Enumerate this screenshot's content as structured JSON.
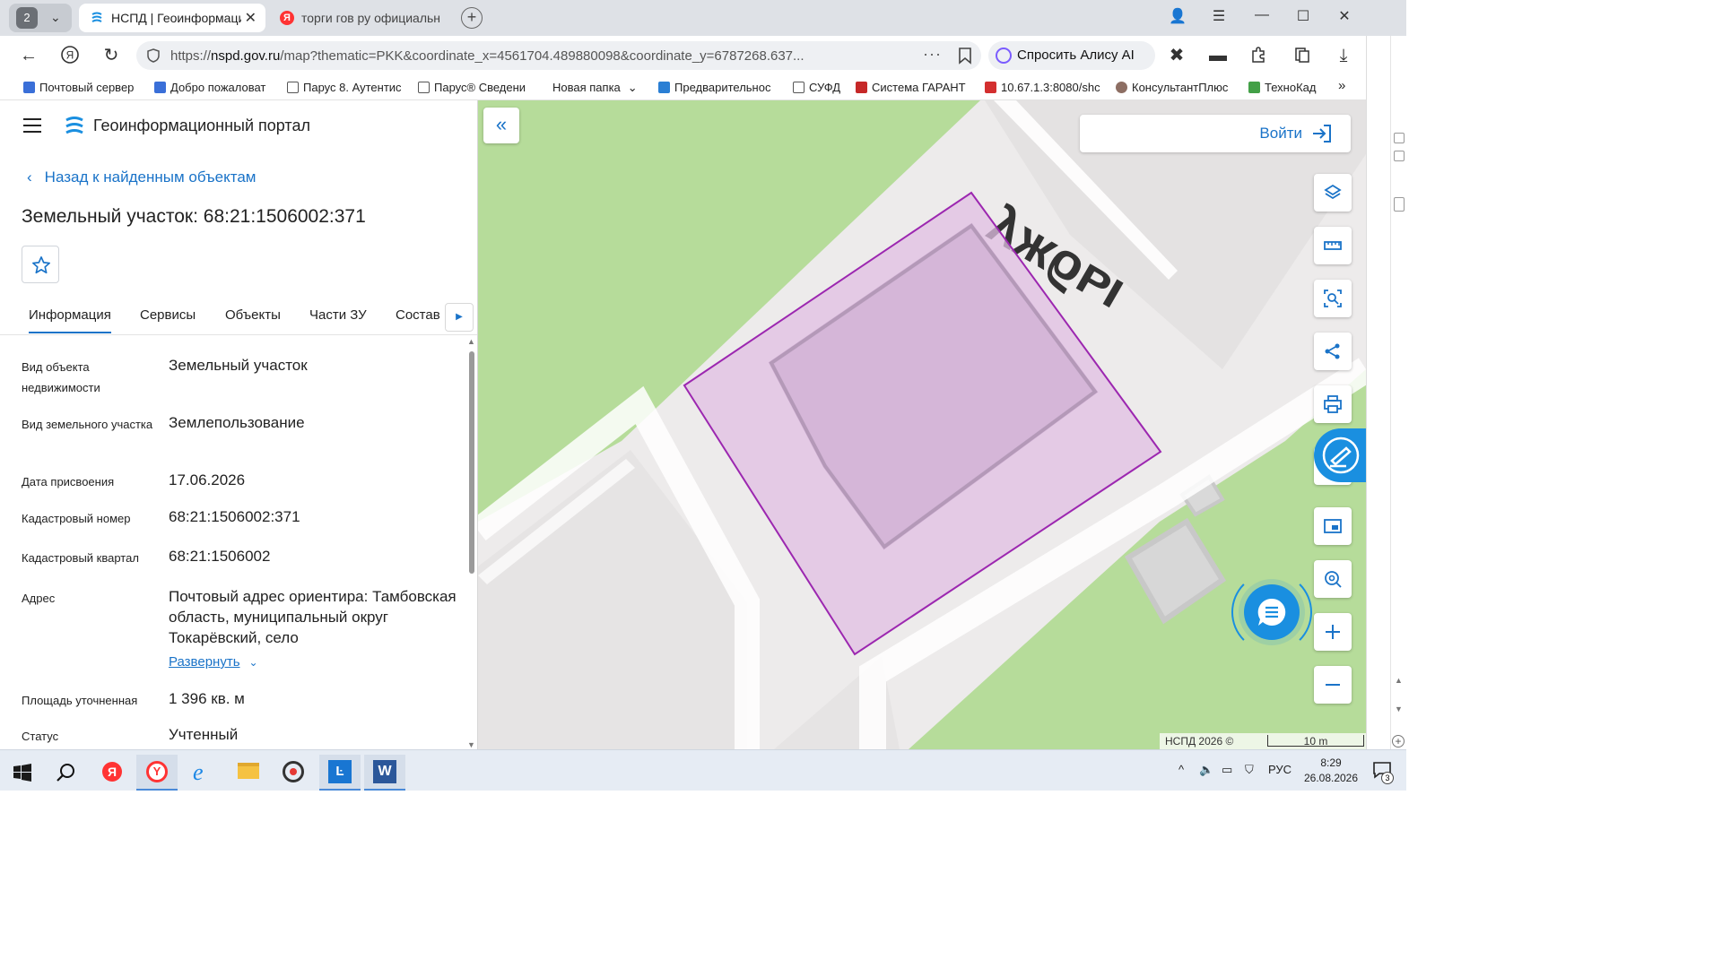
{
  "browser": {
    "tab_count": "2",
    "tabs": [
      {
        "title": "НСПД | Геоинформаци",
        "active": true
      },
      {
        "title": "торги гов ру официальн",
        "active": false
      }
    ],
    "url_prefix": "https://",
    "url_host": "nspd.gov.ru",
    "url_rest": "/map?thematic=PKK&coordinate_x=4561704.489880098&coordinate_y=6787268.637...",
    "url_more": "···",
    "alice_label": "Спросить Алису AI",
    "bookmarks": [
      "Почтовый сервер",
      "Добро пожаловат",
      "Парус 8. Аутентис",
      "Парус® Сведени",
      "Новая папка",
      "Предварительнос",
      "СУФД",
      "Система ГАРАНТ",
      "10.67.1.3:8080/shc",
      "КонсультантПлюс",
      "ТехноКад"
    ],
    "bookmarks_more": "»"
  },
  "panel": {
    "portal_title": "Геоинформационный портал",
    "back_label": "Назад к найденным объектам",
    "object_title": "Земельный участок: 68:21:1506002:371",
    "tabs": [
      "Информация",
      "Сервисы",
      "Объекты",
      "Части ЗУ",
      "Состав"
    ],
    "rows": [
      {
        "label": "Вид объекта недвижимости",
        "value": "Земельный участок"
      },
      {
        "label": "Вид земельного участка",
        "value": "Землепользование"
      },
      {
        "label": "Дата присвоения",
        "value": "17.06.2026"
      },
      {
        "label": "Кадастровый номер",
        "value": "68:21:1506002:371"
      },
      {
        "label": "Кадастровый квартал",
        "value": "68:21:1506002"
      },
      {
        "label": "Адрес",
        "value": "Почтовый адрес ориентира: Тамбовская область, муниципальный округ Токарёвский, село"
      },
      {
        "label": "Площадь уточненная",
        "value": "1 396 кв. м"
      },
      {
        "label": "Статус",
        "value": "Учтенный"
      }
    ],
    "expand_label": "Развернуть"
  },
  "map": {
    "street_label": "ужбы",
    "login_label": "Войти",
    "attribution": "НСПД 2026 ©",
    "scale_label": "10 m",
    "parcel_color": "#9c27b0",
    "fill_color": "#e4c6e6",
    "green_color": "#b6dc9a"
  },
  "taskbar": {
    "lang": "РУС",
    "time": "8:29",
    "date": "26.08.2026",
    "notifications": "3"
  }
}
